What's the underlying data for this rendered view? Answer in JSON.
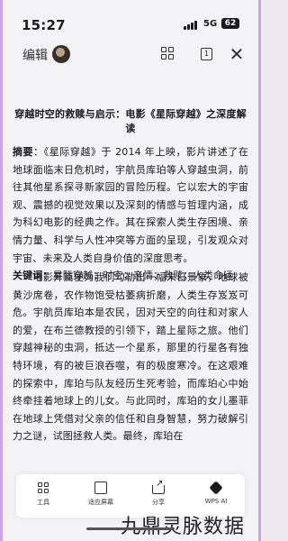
{
  "status_bar": {
    "time": "15:27",
    "network": "5G",
    "battery": "62"
  },
  "toolbar": {
    "edit_label": "编辑"
  },
  "article": {
    "title": "穿越时空的救赎与启示：电影《星际穿越》之深度解读",
    "abstract_label": "摘要",
    "abstract_text": "：《星际穿越》于 2014 年上映，影片讲述了在地球面临末日危机时，宇航员库珀等人穿越虫洞，前往其他星系探寻新家园的冒险历程。它以宏大的宇宙观、震撼的视觉效果以及深刻的情感与哲理内涵，成为科幻电影的经典之作。其在探索人类生存困境、亲情力量、科学与人性冲突等方面的呈现，引发观众对宇宙、未来及人类自身价值的深度思考。",
    "keywords_label": "关键词",
    "keywords_text": "：星际穿越；时空；亲情；救赎；人类命运",
    "body_text": "电影开篇便为我们勾勒出一幅末日景象，地球被黄沙席卷，农作物饱受枯萎病折磨，人类生存岌岌可危。宇航员库珀本是农民，因对天空的向往和对家人的爱，在布兰德教授的引领下，踏上星际之旅。他们穿越神秘的虫洞，抵达一个星系，那里的行星各有独特环境，有的被巨浪吞噬，有的极度寒冷。在这艰难的探索中，库珀与队友经历生死考验，而库珀心中始终牵挂着地球上的儿女。与此同时，库珀的女儿墨菲在地球上凭借对父亲的信任和自身智慧，努力破解引力之谜，试图拯救人类。最终，库珀在"
  },
  "bottom_bar": {
    "items": [
      {
        "label": "工具",
        "icon": "tools-grid-icon"
      },
      {
        "label": "适应屏幕",
        "icon": "fit-screen-icon"
      },
      {
        "label": "分享",
        "icon": "share-icon"
      },
      {
        "label": "WPS AI",
        "icon": "wps-ai-icon"
      }
    ]
  },
  "watermark": "九鼎灵脉数据"
}
